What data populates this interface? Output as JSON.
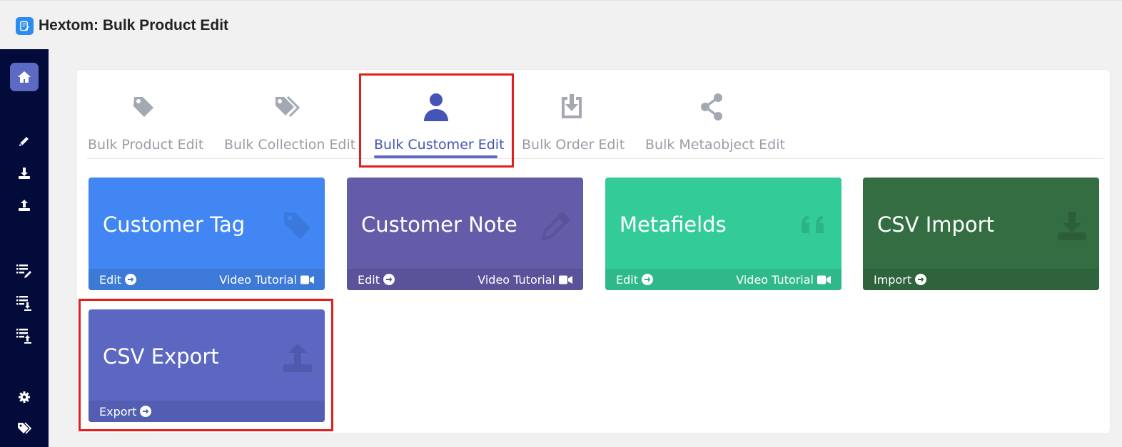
{
  "app": {
    "title": "Hextom: Bulk Product Edit",
    "icon": "app-icon"
  },
  "sidebar": {
    "items": [
      {
        "name": "home",
        "icon": "home-icon",
        "active": true
      },
      {
        "name": "edit",
        "icon": "pencil-icon"
      },
      {
        "name": "import",
        "icon": "download-icon"
      },
      {
        "name": "export",
        "icon": "upload-icon"
      },
      {
        "name": "list-edit",
        "icon": "list-pencil-icon"
      },
      {
        "name": "list-import",
        "icon": "list-download-icon"
      },
      {
        "name": "list-export",
        "icon": "list-upload-icon"
      },
      {
        "name": "settings",
        "icon": "gear-icon"
      },
      {
        "name": "tags",
        "icon": "tags-icon"
      }
    ]
  },
  "tabs": [
    {
      "label": "Bulk Product Edit",
      "icon": "tag-icon",
      "active": false
    },
    {
      "label": "Bulk Collection Edit",
      "icon": "tags-icon",
      "active": false
    },
    {
      "label": "Bulk Customer Edit",
      "icon": "user-icon",
      "active": true
    },
    {
      "label": "Bulk Order Edit",
      "icon": "download-box-icon",
      "active": false
    },
    {
      "label": "Bulk Metaobject Edit",
      "icon": "share-icon",
      "active": false
    }
  ],
  "cards": [
    {
      "title": "Customer Tag",
      "icon": "tag-icon",
      "color": "#4286f4",
      "foot_color": "#3d7ad8",
      "link": "Edit",
      "tutorial": "Video Tutorial"
    },
    {
      "title": "Customer Note",
      "icon": "pencil-icon",
      "color": "#635ca8",
      "foot_color": "#5a539a",
      "link": "Edit",
      "tutorial": "Video Tutorial"
    },
    {
      "title": "Metafields",
      "icon": "quote-icon",
      "color": "#33cc99",
      "foot_color": "#2fb98b",
      "link": "Edit",
      "tutorial": "Video Tutorial"
    },
    {
      "title": "CSV Import",
      "icon": "download-icon",
      "color": "#336d41",
      "foot_color": "#2f633c",
      "link": "Import"
    },
    {
      "title": "CSV Export",
      "icon": "upload-icon",
      "color": "#5c67c2",
      "foot_color": "#535db2",
      "link": "Export"
    }
  ],
  "colors": {
    "highlight": "#e0201c",
    "sidebar": "#020b3a",
    "accent": "#5c6ac4"
  }
}
